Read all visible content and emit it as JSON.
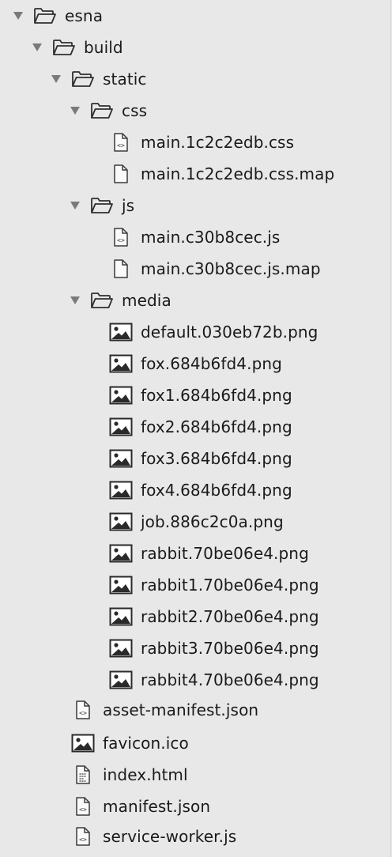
{
  "tree": [
    {
      "label": "esna",
      "type": "folder",
      "expanded": true,
      "depth": 0,
      "icon": "folder-open-icon"
    },
    {
      "label": "build",
      "type": "folder",
      "expanded": true,
      "depth": 1,
      "icon": "folder-open-icon"
    },
    {
      "label": "static",
      "type": "folder",
      "expanded": true,
      "depth": 2,
      "icon": "folder-open-icon"
    },
    {
      "label": "css",
      "type": "folder",
      "expanded": true,
      "depth": 3,
      "icon": "folder-open-icon"
    },
    {
      "label": "main.1c2c2edb.css",
      "type": "file",
      "depth": 4,
      "icon": "code-file-icon"
    },
    {
      "label": "main.1c2c2edb.css.map",
      "type": "file",
      "depth": 4,
      "icon": "blank-file-icon"
    },
    {
      "label": "js",
      "type": "folder",
      "expanded": true,
      "depth": 3,
      "icon": "folder-open-icon"
    },
    {
      "label": "main.c30b8cec.js",
      "type": "file",
      "depth": 4,
      "icon": "code-file-icon"
    },
    {
      "label": "main.c30b8cec.js.map",
      "type": "file",
      "depth": 4,
      "icon": "blank-file-icon"
    },
    {
      "label": "media",
      "type": "folder",
      "expanded": true,
      "depth": 3,
      "icon": "folder-open-icon"
    },
    {
      "label": "default.030eb72b.png",
      "type": "file",
      "depth": 4,
      "icon": "image-file-icon"
    },
    {
      "label": "fox.684b6fd4.png",
      "type": "file",
      "depth": 4,
      "icon": "image-file-icon"
    },
    {
      "label": "fox1.684b6fd4.png",
      "type": "file",
      "depth": 4,
      "icon": "image-file-icon"
    },
    {
      "label": "fox2.684b6fd4.png",
      "type": "file",
      "depth": 4,
      "icon": "image-file-icon"
    },
    {
      "label": "fox3.684b6fd4.png",
      "type": "file",
      "depth": 4,
      "icon": "image-file-icon"
    },
    {
      "label": "fox4.684b6fd4.png",
      "type": "file",
      "depth": 4,
      "icon": "image-file-icon"
    },
    {
      "label": "job.886c2c0a.png",
      "type": "file",
      "depth": 4,
      "icon": "image-file-icon"
    },
    {
      "label": "rabbit.70be06e4.png",
      "type": "file",
      "depth": 4,
      "icon": "image-file-icon"
    },
    {
      "label": "rabbit1.70be06e4.png",
      "type": "file",
      "depth": 4,
      "icon": "image-file-icon"
    },
    {
      "label": "rabbit2.70be06e4.png",
      "type": "file",
      "depth": 4,
      "icon": "image-file-icon"
    },
    {
      "label": "rabbit3.70be06e4.png",
      "type": "file",
      "depth": 4,
      "icon": "image-file-icon"
    },
    {
      "label": "rabbit4.70be06e4.png",
      "type": "file",
      "depth": 4,
      "icon": "image-file-icon"
    },
    {
      "label": "asset-manifest.json",
      "type": "file",
      "depth": 2,
      "icon": "code-file-icon"
    },
    {
      "label": "favicon.ico",
      "type": "file",
      "depth": 2,
      "icon": "image-file-icon"
    },
    {
      "label": "index.html",
      "type": "file",
      "depth": 2,
      "icon": "html-file-icon"
    },
    {
      "label": "manifest.json",
      "type": "file",
      "depth": 2,
      "icon": "code-file-icon"
    },
    {
      "label": "service-worker.js",
      "type": "file",
      "depth": 2,
      "icon": "code-file-icon"
    }
  ],
  "colors": {
    "background": "#e8e8e8",
    "text": "#1a1a1a",
    "icon_stroke": "#3a3a3a",
    "arrow": "#7a7a7a"
  }
}
